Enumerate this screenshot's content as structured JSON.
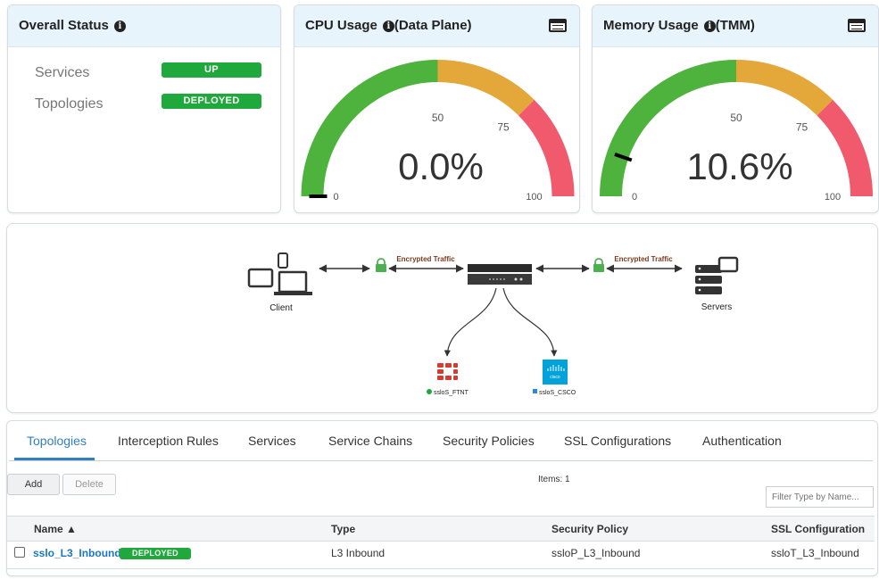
{
  "overall_status": {
    "title": "Overall Status",
    "rows": [
      {
        "label": "Services",
        "badge": "UP"
      },
      {
        "label": "Topologies",
        "badge": "DEPLOYED"
      }
    ]
  },
  "cpu": {
    "title": "CPU Usage",
    "note": "(Data Plane)",
    "value_text": "0.0%",
    "value": 0.0,
    "ticks": [
      "0",
      "50",
      "75",
      "100"
    ]
  },
  "memory": {
    "title": "Memory Usage",
    "note": "(TMM)",
    "value_text": "10.6%",
    "value": 10.6,
    "ticks": [
      "0",
      "50",
      "75",
      "100"
    ]
  },
  "gauge_colors": {
    "green": "#4db33d",
    "orange": "#e3a73a",
    "red": "#f15a6c"
  },
  "diagram": {
    "client_label": "Client",
    "servers_label": "Servers",
    "encrypted_left": "Encrypted Traffic",
    "encrypted_right": "Encrypted Traffic",
    "service_1": "ssloS_FTNT",
    "service_2": "ssloS_CSCO",
    "cisco_text": "cisco"
  },
  "tabs": [
    "Topologies",
    "Interception Rules",
    "Services",
    "Service Chains",
    "Security Policies",
    "SSL Configurations",
    "Authentication"
  ],
  "toolbar": {
    "add": "Add",
    "delete": "Delete",
    "items_count": "Items: 1",
    "filter_placeholder": "Filter Type by Name..."
  },
  "table": {
    "headers": {
      "name": "Name ▲",
      "type": "Type",
      "policy": "Security Policy",
      "ssl": "SSL Configuration"
    },
    "rows": [
      {
        "name": "sslo_L3_Inbound",
        "status": "DEPLOYED",
        "type": "L3 Inbound",
        "policy": "ssloP_L3_Inbound",
        "ssl": "ssloT_L3_Inbound"
      }
    ]
  }
}
